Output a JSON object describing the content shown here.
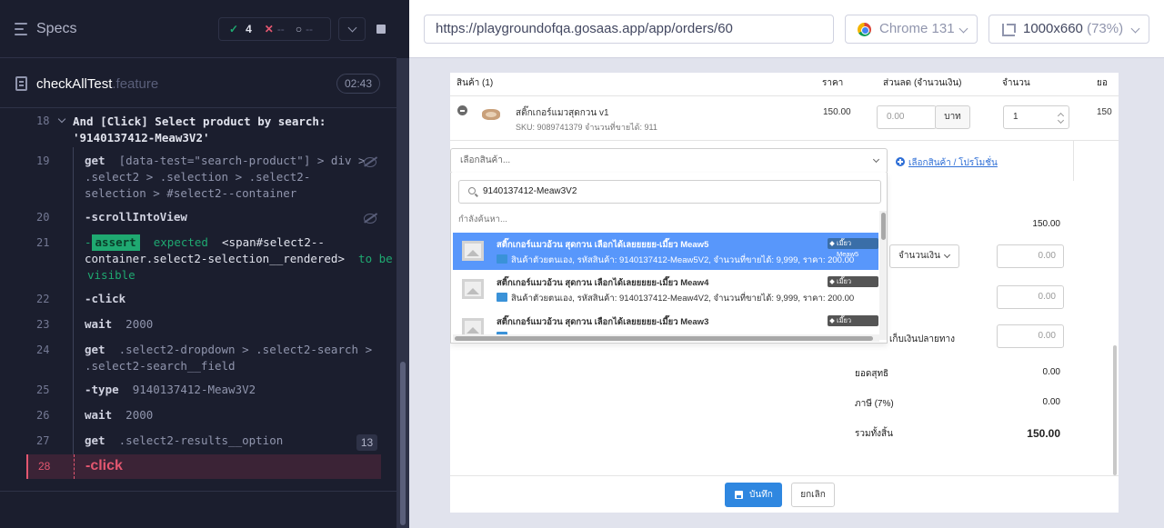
{
  "specs_title": "Specs",
  "stats": {
    "passed": "4",
    "failed": "--",
    "pending": "--",
    "pass_glyph": "✓",
    "fail_glyph": "✕",
    "pend_glyph": "○"
  },
  "spec_file": {
    "name": "checkAllTest",
    "ext": ".feature",
    "duration": "02:43"
  },
  "step": {
    "line": "18",
    "text_1": "And   [Click] Select product by search:",
    "text_2": "'9140137412-Meaw3V2'"
  },
  "commands": [
    {
      "line": "19",
      "name": "get",
      "arg_1": "[data-test=\"search-product\"] > div >",
      "arg_2": ".select2 > .selection > .select2-",
      "arg_3": "selection > #select2--container"
    },
    {
      "line": "20",
      "name": "-scrollIntoView"
    },
    {
      "line": "21",
      "prefix": "-",
      "badge": "assert",
      "w1": "expected",
      "w2": "<span#select2--",
      "w3": "container.select2-selection__rendered>",
      "w4": "to be",
      "w5": "visible"
    },
    {
      "line": "22",
      "name": "-click"
    },
    {
      "line": "23",
      "name": "wait",
      "arg_1": "2000"
    },
    {
      "line": "24",
      "name": "get",
      "arg_1": ".select2-dropdown > .select2-search >",
      "arg_2": ".select2-search__field"
    },
    {
      "line": "25",
      "name": "-type",
      "arg_1": "9140137412-Meaw3V2"
    },
    {
      "line": "26",
      "name": "wait",
      "arg_1": "2000"
    },
    {
      "line": "27",
      "name": "get",
      "arg_1": ".select2-results__option",
      "count": "13"
    },
    {
      "line": "28",
      "name": "-click"
    }
  ],
  "browser": {
    "url": "https://playgroundofqa.gosaas.app/app/orders/60",
    "name": "Chrome 131",
    "viewport": "1000x660",
    "scale": "(73%)"
  },
  "app": {
    "headers": {
      "product": "สินค้า (1)",
      "price": "ราคา",
      "discount": "ส่วนลด (จำนวนเงิน)",
      "qty": "จำนวน",
      "total": "ยอ"
    },
    "line_item": {
      "name": "สติ๊กเกอร์แมวสุดกวน v1",
      "sku_line": "SKU: 9089741379 จำนวนที่ขายได้: 911",
      "price": "150.00",
      "discount_placeholder": "0.00",
      "discount_unit": "บาท",
      "qty": "1",
      "total": "150"
    },
    "select_placeholder": "เลือกสินค้า...",
    "add_link": "เลือกสินค้า / โปรโมชั่น",
    "search_value": "9140137412-Meaw3V2",
    "searching_text": "กำลังค้นหา...",
    "options": [
      {
        "title": "สติ๊กเกอร์แมวอ้วน สุดกวน เลือกได้เลยยยยย-เมี๊ยว Meaw5",
        "sub": "สินค้าตัวยตนเอง,   รหัสสินค้า: 9140137412-Meaw5V2,   จำนวนที่ขายได้: 9,999,   ราคา: 200.00",
        "tag": "เมี๊ยว Meaw5"
      },
      {
        "title": "สติ๊กเกอร์แมวอ้วน สุดกวน เลือกได้เลยยยยย-เมี๊ยว Meaw4",
        "sub": "สินค้าตัวยตนเอง,   รหัสสินค้า: 9140137412-Meaw4V2,   จำนวนที่ขายได้: 9,999,   ราคา: 200.00",
        "tag": "เมี๊ยว Meaw4"
      },
      {
        "title": "สติ๊กเกอร์แมวอ้วน สุดกวน เลือกได้เลยยยยย-เมี๊ยว Meaw3",
        "sub": "",
        "tag": "เมี๊ยว Meaw3"
      }
    ],
    "summary": {
      "subtotal": "150.00",
      "discount_mode": "จำนวนเงิน",
      "discount_value": "0.00",
      "shipping_value": "0.00",
      "cod_label": "เก็บเงินปลายทาง",
      "cod_value": "0.00",
      "net_label": "ยอดสุทธิ",
      "net_value": "0.00",
      "vat_label": "ภาษี (7%)",
      "vat_value": "0.00",
      "grand_label": "รวมทั้งสิ้น",
      "grand_value": "150.00"
    },
    "save_label": "บันทึก",
    "cancel_label": "ยกเลิก"
  }
}
